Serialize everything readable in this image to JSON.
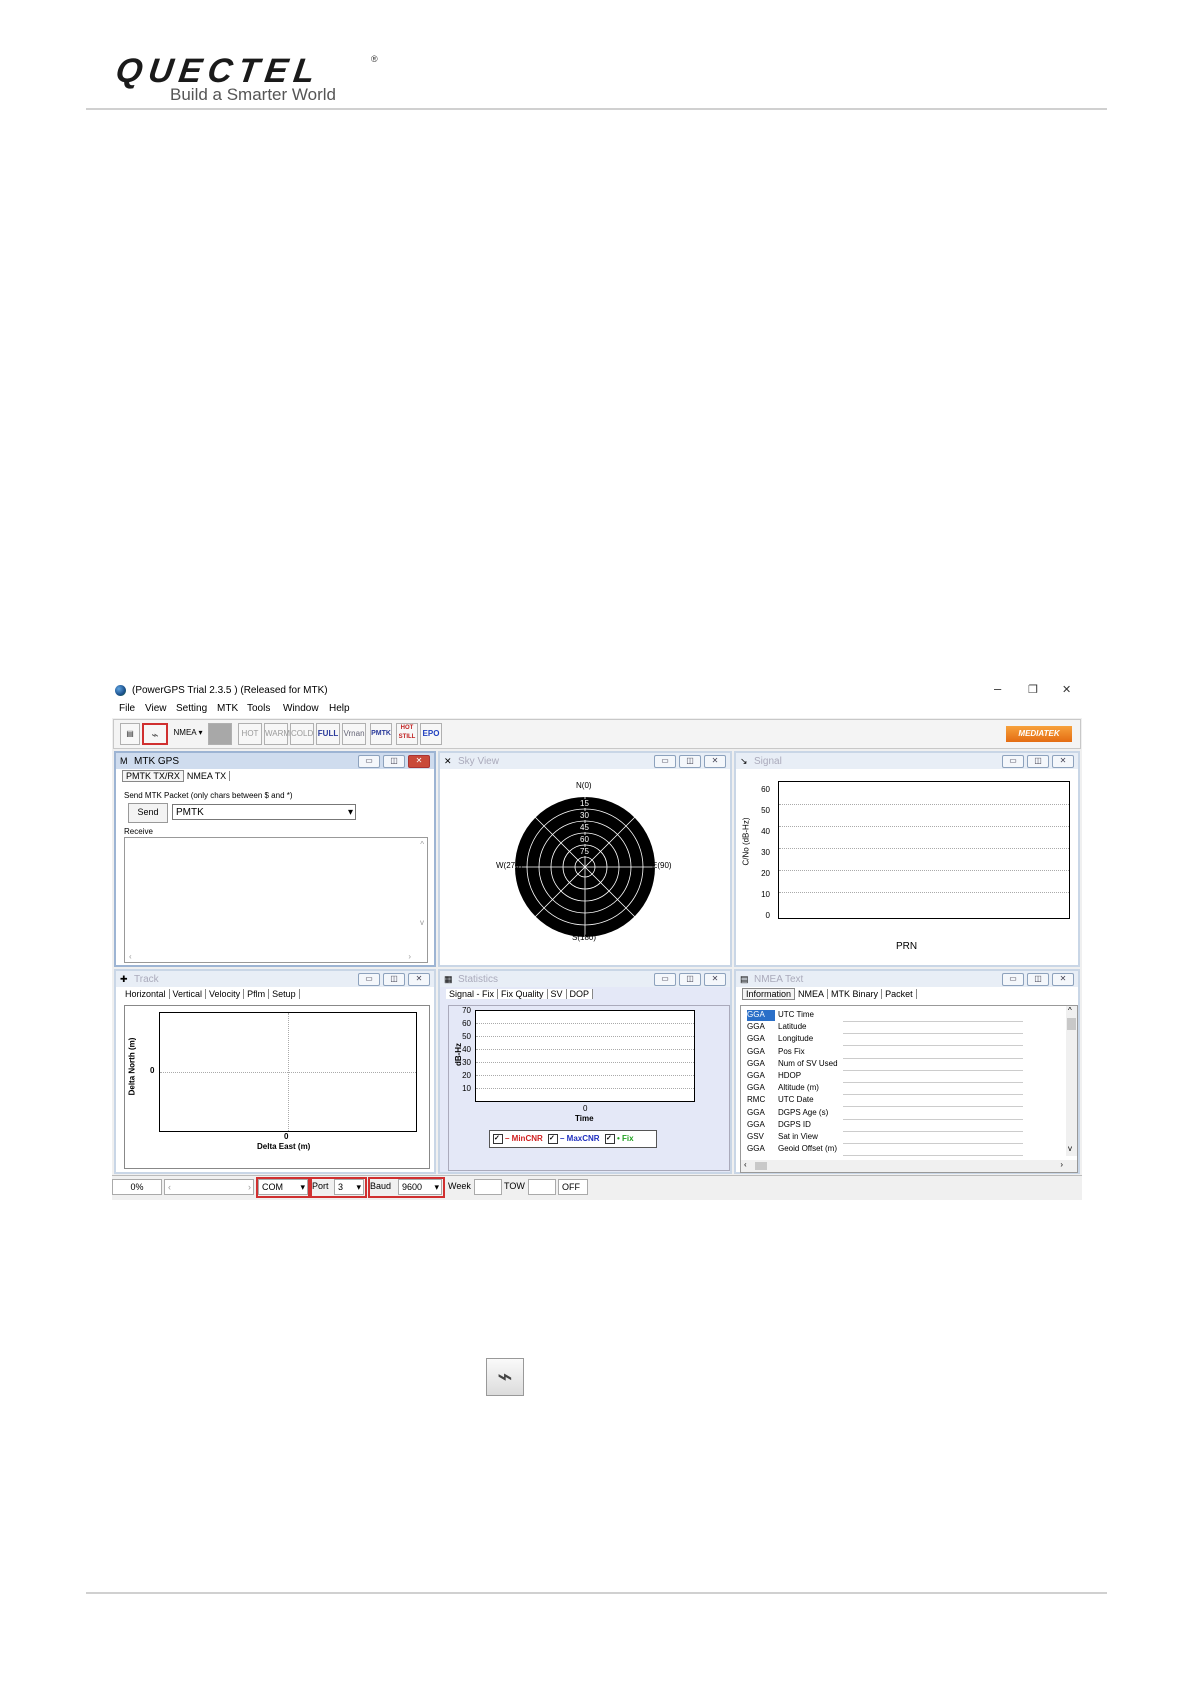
{
  "header": {
    "logo_text": "QUECTEL",
    "logo_reg": "®",
    "tagline": "Build a Smarter World"
  },
  "window": {
    "title": "(PowerGPS Trial 2.3.5 ) (Released for MTK)",
    "controls": {
      "minimize": "–",
      "restore": "❐",
      "close": "✕"
    },
    "menu": [
      "File",
      "View",
      "Setting",
      "MTK",
      "Tools",
      "Window",
      "Help"
    ],
    "toolbar": {
      "protocol": "NMEA",
      "buttons": [
        "HOT",
        "WARM",
        "COLD",
        "FULL",
        "Vrnan"
      ],
      "pmtk": "PMTK",
      "hot_still": "HOT STILL",
      "epo": "EPO",
      "brand": "MEDIATEK"
    }
  },
  "mtk_panel": {
    "title": "MTK GPS",
    "tabs": [
      "PMTK TX/RX",
      "NMEA TX"
    ],
    "send_group": "Send MTK Packet (only chars between $ and *)",
    "send_button": "Send",
    "packet_value": "PMTK",
    "receive_label": "Receive"
  },
  "sky_panel": {
    "title": "Sky View",
    "labels": {
      "n": "N(0)",
      "e": "E(90)",
      "s": "S(180)",
      "w": "W(270)"
    },
    "rings": [
      "15",
      "30",
      "45",
      "60",
      "75"
    ]
  },
  "signal_panel": {
    "title": "Signal",
    "ylabel": "C/No (dB-Hz)",
    "xlabel": "PRN",
    "ticks": [
      "60",
      "50",
      "40",
      "30",
      "20",
      "10",
      "0"
    ]
  },
  "track_panel": {
    "title": "Track",
    "tabs": [
      "Horizontal",
      "Vertical",
      "Velocity",
      "Pflm",
      "Setup"
    ],
    "ylabel": "Delta North (m)",
    "xlabel": "Delta East (m)",
    "zero": "0"
  },
  "stats_panel": {
    "title": "Statistics",
    "tabs": [
      "Signal - Fix",
      "Fix Quality",
      "SV",
      "DOP"
    ],
    "ylabel": "dB-Hz",
    "xlabel": "Time",
    "zero": "0",
    "ticks": [
      "70",
      "60",
      "50",
      "40",
      "30",
      "20",
      "10"
    ],
    "legend": [
      {
        "label": "– MinCNR",
        "color": "#d02020"
      },
      {
        "label": "– MaxCNR",
        "color": "#2030c0"
      },
      {
        "label": "• Fix",
        "color": "#20a020"
      }
    ]
  },
  "nmea_panel": {
    "title": "NMEA Text",
    "tabs": [
      "Information",
      "NMEA",
      "MTK Binary",
      "Packet"
    ],
    "rows": [
      [
        "GGA",
        "UTC Time"
      ],
      [
        "GGA",
        "Latitude"
      ],
      [
        "GGA",
        "Longitude"
      ],
      [
        "GGA",
        "Pos Fix"
      ],
      [
        "GGA",
        "Num of SV Used"
      ],
      [
        "GGA",
        "HDOP"
      ],
      [
        "GGA",
        "Altitude (m)"
      ],
      [
        "RMC",
        "UTC Date"
      ],
      [
        "GGA",
        "DGPS Age (s)"
      ],
      [
        "GGA",
        "DGPS ID"
      ],
      [
        "GSV",
        "Sat in View"
      ],
      [
        "GGA",
        "Geoid Offset (m)"
      ]
    ]
  },
  "status": {
    "progress": "0%",
    "com": "COM",
    "port_label": "Port",
    "port_value": "3",
    "baud_label": "Baud",
    "baud_value": "9600",
    "week": "Week",
    "tow": "TOW",
    "off": "OFF"
  }
}
